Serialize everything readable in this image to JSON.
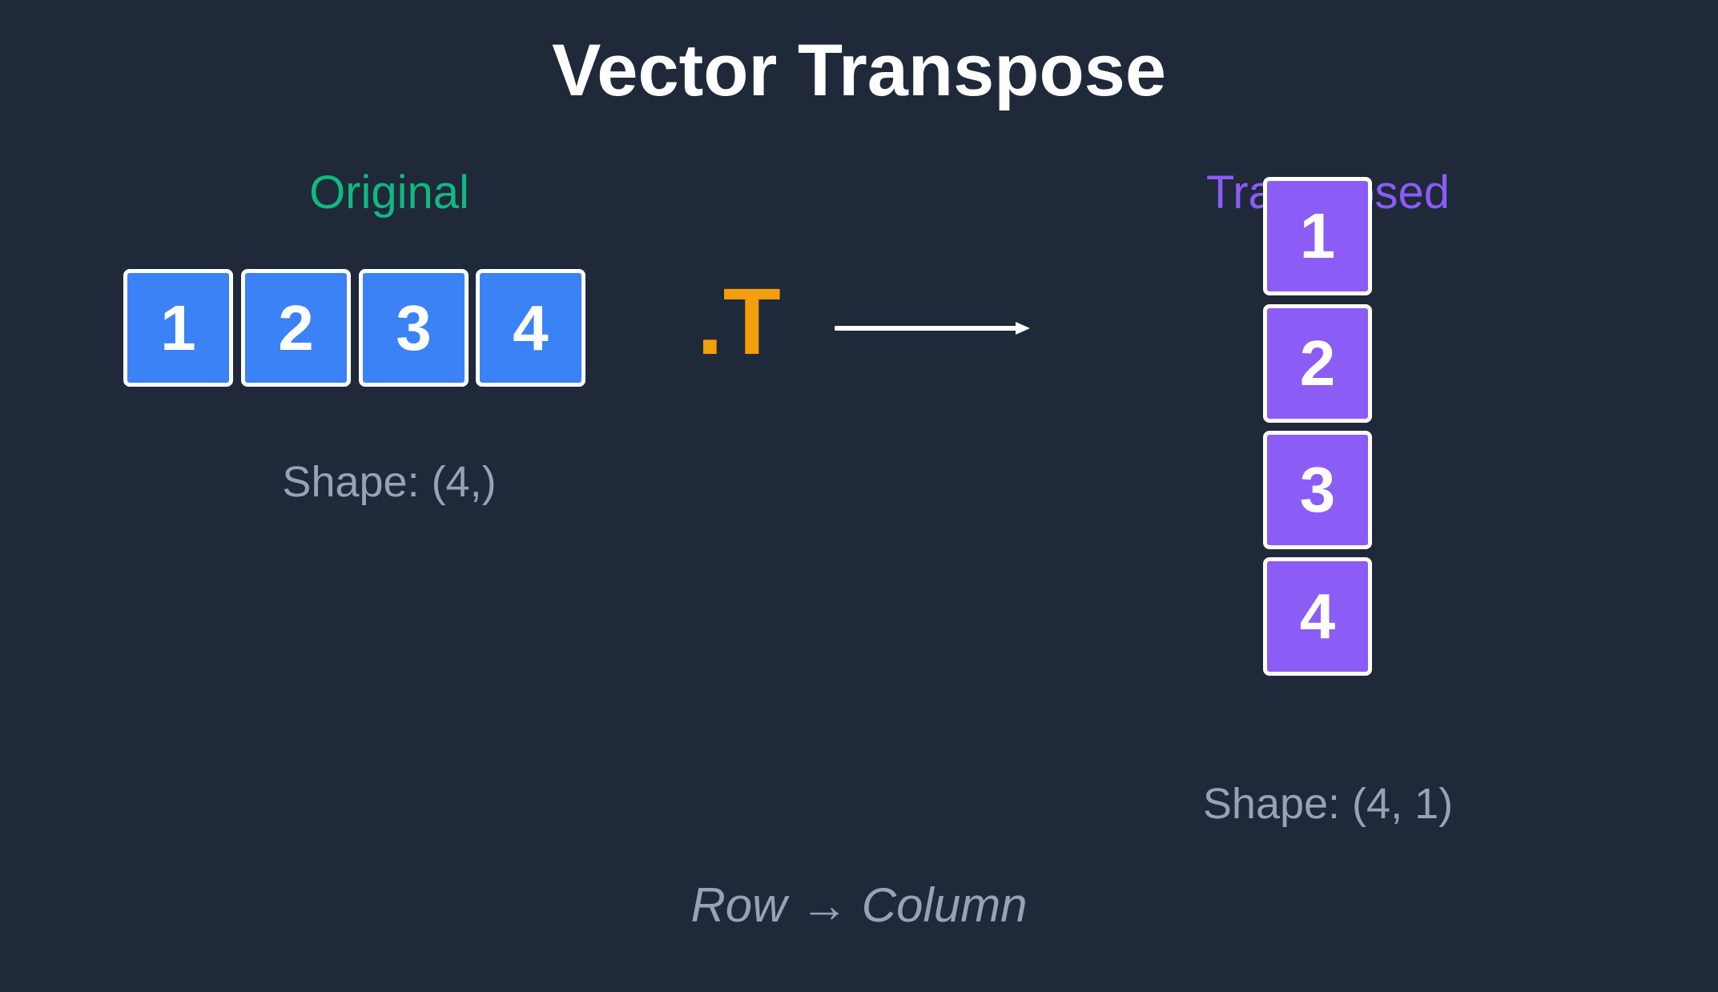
{
  "title": "Vector Transpose",
  "original": {
    "label": "Original",
    "values": [
      "1",
      "2",
      "3",
      "4"
    ],
    "shape": "Shape: (4,)",
    "color": "#3b82f6",
    "label_color": "#10b981"
  },
  "operator": ".T",
  "transposed": {
    "label": "Transposed",
    "values": [
      "1",
      "2",
      "3",
      "4"
    ],
    "shape": "Shape: (4, 1)",
    "color": "#8b5cf6",
    "label_color": "#8b5cf6"
  },
  "caption": "Row → Column",
  "colors": {
    "background": "#1f293a",
    "operator": "#f59e0b",
    "muted_text": "#94a3b8"
  }
}
